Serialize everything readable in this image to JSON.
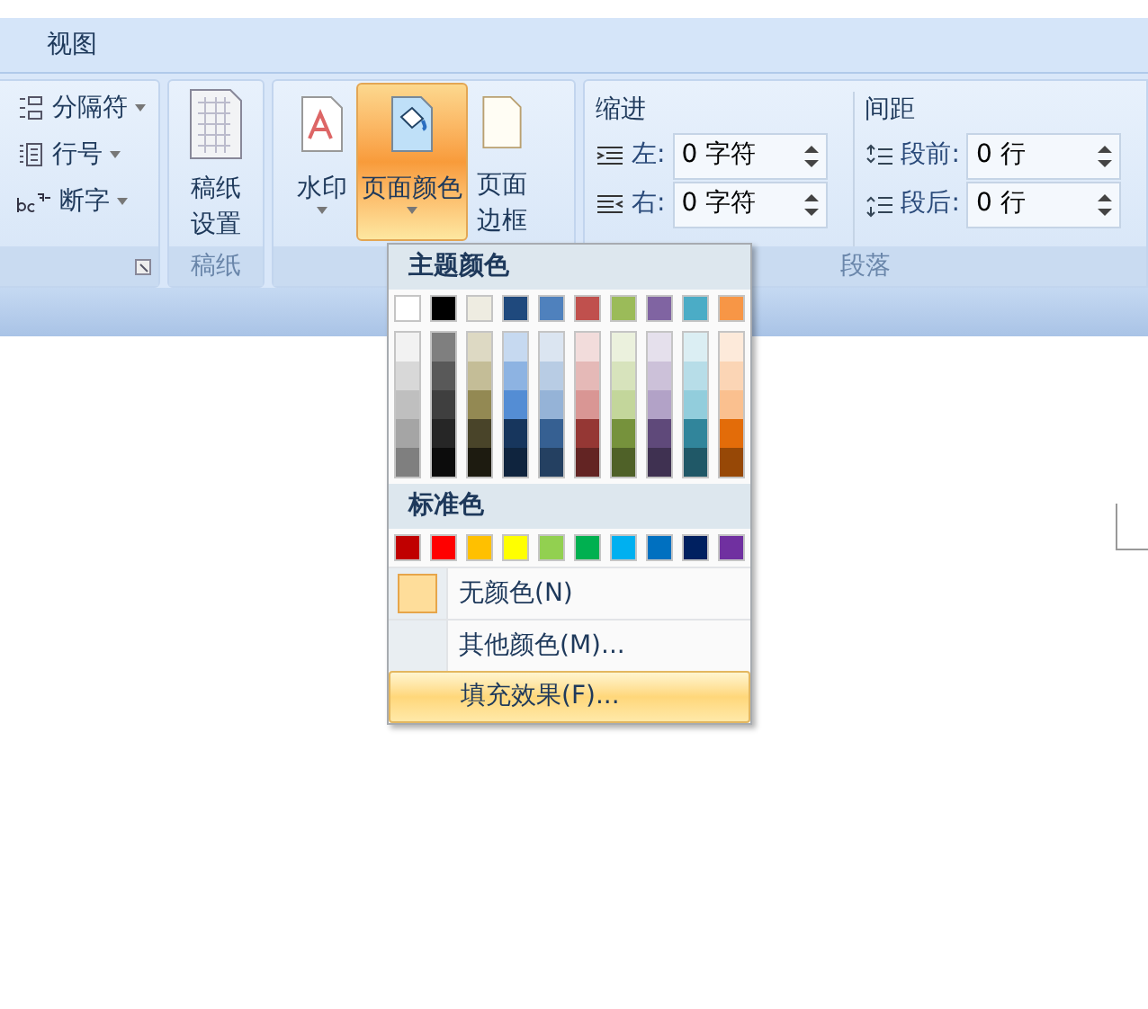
{
  "tabs": [
    {
      "label": "视图",
      "selected": false
    }
  ],
  "ribbon": {
    "left_group": {
      "items": [
        {
          "label": "分隔符",
          "kind": "breaks"
        },
        {
          "label": "行号",
          "kind": "linenum"
        },
        {
          "label": "断字",
          "kind": "hyphen"
        }
      ]
    },
    "paper_group": {
      "button": {
        "label": "稿纸",
        "label2": "设置"
      },
      "group_label": "稿纸"
    },
    "background_group": {
      "buttons": [
        {
          "label": "水印",
          "kind": "watermark",
          "selected": false
        },
        {
          "label": "页面颜色",
          "kind": "pagecolor",
          "selected": true
        },
        {
          "label": "页面",
          "label2": "边框",
          "kind": "border"
        }
      ]
    },
    "paragraph_group": {
      "indent_title": "缩进",
      "spacing_title": "间距",
      "indent": [
        {
          "label": "左:",
          "value": "0 字符",
          "kind": "left"
        },
        {
          "label": "右:",
          "value": "0 字符",
          "kind": "right"
        }
      ],
      "spacing": [
        {
          "label": "段前:",
          "value": "0 行",
          "kind": "before"
        },
        {
          "label": "段后:",
          "value": "0 行",
          "kind": "after"
        }
      ],
      "group_label": "段落"
    }
  },
  "color_menu": {
    "theme_title": "主题颜色",
    "theme_colors": [
      {
        "color": "#ffffff",
        "shades": [
          {
            "color": "#f2f2f2"
          },
          {
            "color": "#d8d8d8"
          },
          {
            "color": "#bfbfbf"
          },
          {
            "color": "#a5a5a5"
          },
          {
            "color": "#7f7f7f"
          }
        ]
      },
      {
        "color": "#000000",
        "shades": [
          {
            "color": "#7f7f7f"
          },
          {
            "color": "#595959"
          },
          {
            "color": "#3f3f3f"
          },
          {
            "color": "#262626"
          },
          {
            "color": "#0c0c0c"
          }
        ]
      },
      {
        "color": "#eeece1",
        "shades": [
          {
            "color": "#ddd9c3"
          },
          {
            "color": "#c4bd97"
          },
          {
            "color": "#938953"
          },
          {
            "color": "#494429"
          },
          {
            "color": "#1d1b10"
          }
        ]
      },
      {
        "color": "#1f497d",
        "shades": [
          {
            "color": "#c6d9f0"
          },
          {
            "color": "#8db3e2"
          },
          {
            "color": "#548dd4"
          },
          {
            "color": "#17365d"
          },
          {
            "color": "#0f243e"
          }
        ]
      },
      {
        "color": "#4f81bd",
        "shades": [
          {
            "color": "#dbe5f1"
          },
          {
            "color": "#b8cce4"
          },
          {
            "color": "#95b3d7"
          },
          {
            "color": "#366092"
          },
          {
            "color": "#244061"
          }
        ]
      },
      {
        "color": "#c0504d",
        "shades": [
          {
            "color": "#f2dcdb"
          },
          {
            "color": "#e5b9b7"
          },
          {
            "color": "#d99694"
          },
          {
            "color": "#953734"
          },
          {
            "color": "#632423"
          }
        ]
      },
      {
        "color": "#9bbb59",
        "shades": [
          {
            "color": "#ebf1dd"
          },
          {
            "color": "#d7e3bc"
          },
          {
            "color": "#c3d69b"
          },
          {
            "color": "#76923c"
          },
          {
            "color": "#4f6128"
          }
        ]
      },
      {
        "color": "#8064a2",
        "shades": [
          {
            "color": "#e5e0ec"
          },
          {
            "color": "#ccc1d9"
          },
          {
            "color": "#b2a2c7"
          },
          {
            "color": "#5f497a"
          },
          {
            "color": "#3f3151"
          }
        ]
      },
      {
        "color": "#4bacc6",
        "shades": [
          {
            "color": "#dbeef3"
          },
          {
            "color": "#b7dde8"
          },
          {
            "color": "#92cddc"
          },
          {
            "color": "#31859b"
          },
          {
            "color": "#205867"
          }
        ]
      },
      {
        "color": "#f79646",
        "shades": [
          {
            "color": "#fdeada"
          },
          {
            "color": "#fbd5b5"
          },
          {
            "color": "#fac08f"
          },
          {
            "color": "#e36c09"
          },
          {
            "color": "#974806"
          }
        ]
      }
    ],
    "standard_title": "标准色",
    "standard_colors": [
      {
        "color": "#c00000"
      },
      {
        "color": "#ff0000"
      },
      {
        "color": "#ffc000"
      },
      {
        "color": "#ffff00"
      },
      {
        "color": "#92d050"
      },
      {
        "color": "#00b050"
      },
      {
        "color": "#00b0f0"
      },
      {
        "color": "#0070c0"
      },
      {
        "color": "#002060"
      },
      {
        "color": "#7030a0"
      }
    ],
    "items": [
      {
        "label": "无颜色(N)",
        "kind": "none",
        "selected": false
      },
      {
        "label": "其他颜色(M)...",
        "kind": "more",
        "selected": false
      },
      {
        "label": "填充效果(F)...",
        "kind": "fill",
        "selected": true
      }
    ]
  }
}
